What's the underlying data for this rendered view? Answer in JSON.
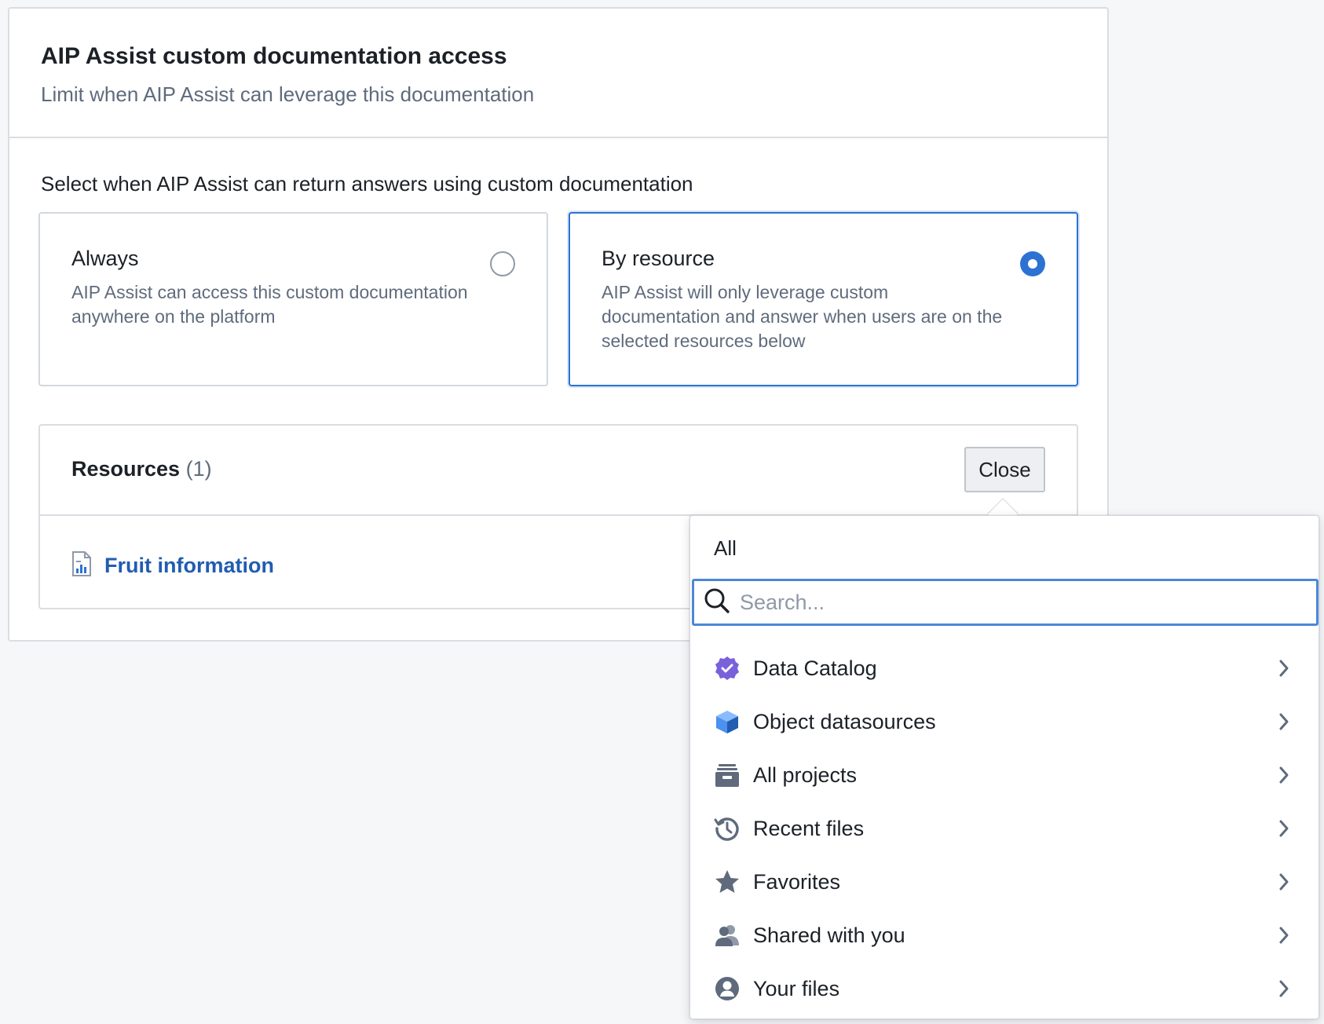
{
  "panel": {
    "title": "AIP Assist custom documentation access",
    "subtitle": "Limit when AIP Assist can leverage this documentation"
  },
  "prompt": "Select when AIP Assist can return answers using custom documentation",
  "options": [
    {
      "title": "Always",
      "description": "AIP Assist can access this custom documentation anywhere on the platform",
      "selected": false
    },
    {
      "title": "By resource",
      "description": "AIP Assist will only leverage custom documentation and answer when users are on the selected resources below",
      "selected": true
    }
  ],
  "resources": {
    "title": "Resources",
    "count": "(1)",
    "close_label": "Close",
    "items": [
      {
        "name": "Fruit information",
        "icon": "chart-file-icon"
      }
    ]
  },
  "dropdown": {
    "all_label": "All",
    "search_placeholder": "Search...",
    "items": [
      {
        "label": "Data Catalog",
        "icon": "verified-badge-icon"
      },
      {
        "label": "Object datasources",
        "icon": "cube-icon"
      },
      {
        "label": "All projects",
        "icon": "archive-box-icon"
      },
      {
        "label": "Recent files",
        "icon": "history-icon"
      },
      {
        "label": "Favorites",
        "icon": "star-icon"
      },
      {
        "label": "Shared with you",
        "icon": "people-icon"
      },
      {
        "label": "Your files",
        "icon": "user-circle-icon"
      }
    ]
  },
  "colors": {
    "accent": "#2d72d2",
    "link": "#215db0",
    "muted_text": "#5f6b7c",
    "data_catalog_purple": "#7961db",
    "cube_blue": "#4c90f0"
  }
}
